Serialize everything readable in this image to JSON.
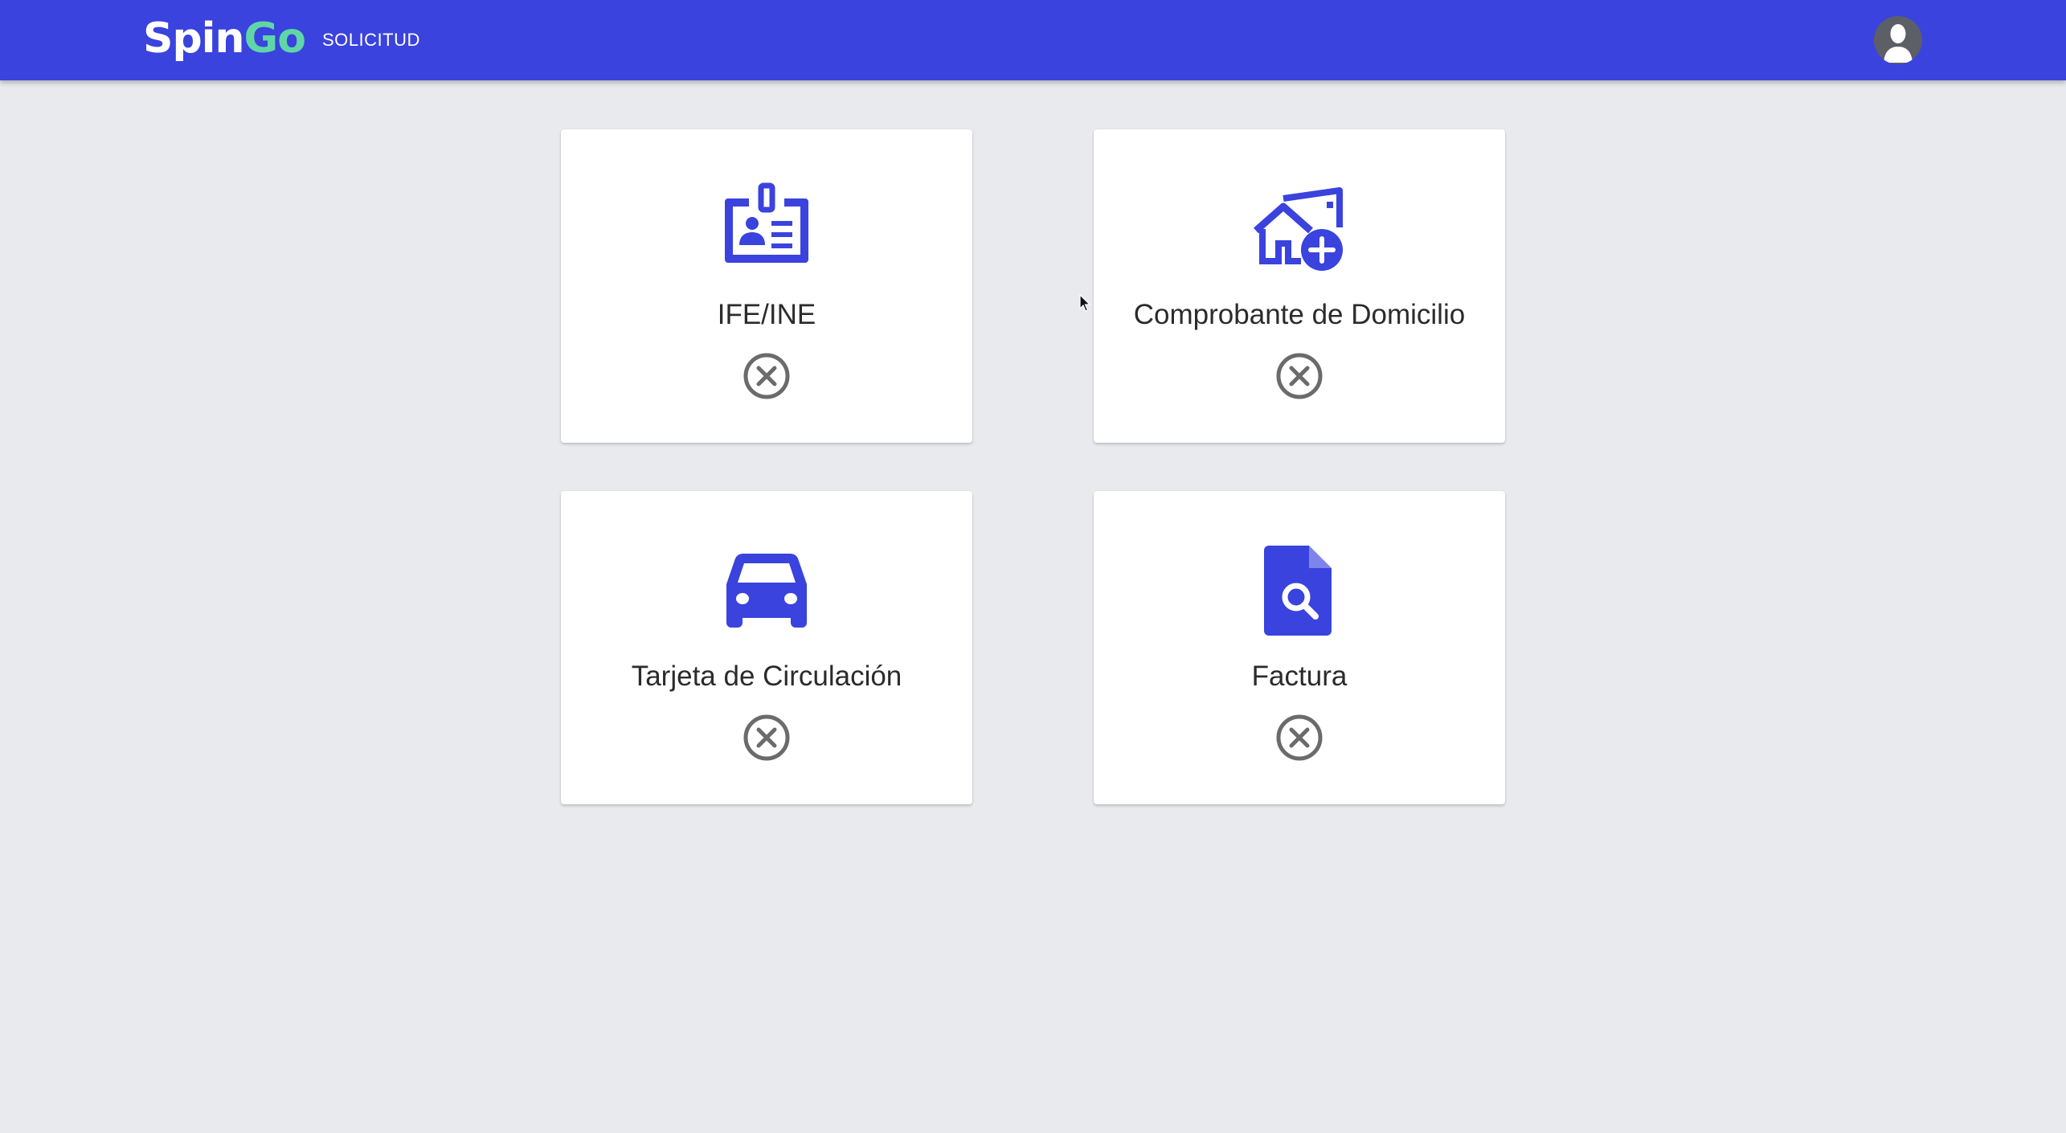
{
  "header": {
    "logo_part1": "Spin",
    "logo_part2": "Go",
    "nav_label": "SOLICITUD",
    "avatar_icon": "user-avatar-icon",
    "colors": {
      "bar": "#3a43dd",
      "logo_accent": "#5fd6a8"
    }
  },
  "cards": [
    {
      "title": "IFE/INE",
      "icon": "id-badge-icon",
      "status": "not-uploaded"
    },
    {
      "title": "Comprobante de Domicilio",
      "icon": "home-add-icon",
      "status": "not-uploaded"
    },
    {
      "title": "Tarjeta de Circulación",
      "icon": "car-icon",
      "status": "not-uploaded"
    },
    {
      "title": "Factura",
      "icon": "file-search-icon",
      "status": "not-uploaded"
    }
  ],
  "colors": {
    "accent": "#3a43dd",
    "status_icon": "#6b6b6b",
    "background": "#e9eaee"
  }
}
